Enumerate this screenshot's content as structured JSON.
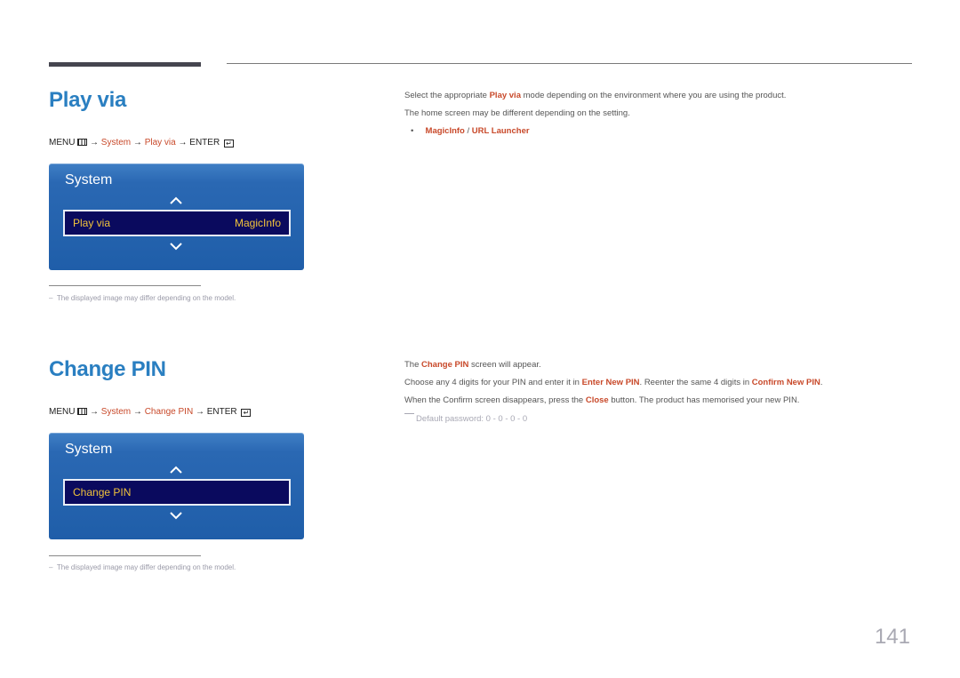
{
  "sections": [
    {
      "title": "Play via",
      "menu_path": {
        "menu": "MENU",
        "menu_icon": "menu-grid-icon",
        "arrow": "→",
        "system": "System",
        "item": "Play via",
        "enter": "ENTER",
        "enter_icon": "enter-icon"
      },
      "osd": {
        "title": "System",
        "selected_label": "Play via",
        "selected_value": "MagicInfo",
        "up_icon": "chevron-up-icon",
        "down_icon": "chevron-down-icon"
      },
      "note": "The displayed image may differ depending on the model.",
      "description": {
        "line1_pre": "Select the appropriate ",
        "line1_hl": "Play via",
        "line1_post": " mode depending on the environment where you are using the product.",
        "line2": "The home screen may be different depending on the setting.",
        "bullet": "•",
        "option1": "MagicInfo",
        "separator": " / ",
        "option2": "URL Launcher"
      }
    },
    {
      "title": "Change PIN",
      "menu_path": {
        "menu": "MENU",
        "menu_icon": "menu-grid-icon",
        "arrow": "→",
        "system": "System",
        "item": "Change PIN",
        "enter": "ENTER",
        "enter_icon": "enter-icon"
      },
      "osd": {
        "title": "System",
        "selected_label": "Change PIN",
        "selected_value": "",
        "up_icon": "chevron-up-icon",
        "down_icon": "chevron-down-icon"
      },
      "note": "The displayed image may differ depending on the model.",
      "description": {
        "line1_pre": "The ",
        "line1_hl": "Change PIN",
        "line1_post": " screen will appear.",
        "line2_pre": "Choose any 4 digits for your PIN and enter it in ",
        "line2_hl1": "Enter New PIN",
        "line2_mid": ". Reenter the same 4 digits in ",
        "line2_hl2": "Confirm New PIN",
        "line2_post": ".",
        "line3_pre": "When the Confirm screen disappears, press the ",
        "line3_hl": "Close",
        "line3_post": " button. The product has memorised your new PIN.",
        "default_password": "Default password: 0 - 0 - 0 - 0"
      }
    }
  ],
  "page_number": "141",
  "colors": {
    "heading": "#2a7fc1",
    "highlight": "#c8492a",
    "osd_bg": "#1f5ea9",
    "osd_selected_bg": "#0a0a5e",
    "osd_selected_text": "#f1c33b"
  }
}
